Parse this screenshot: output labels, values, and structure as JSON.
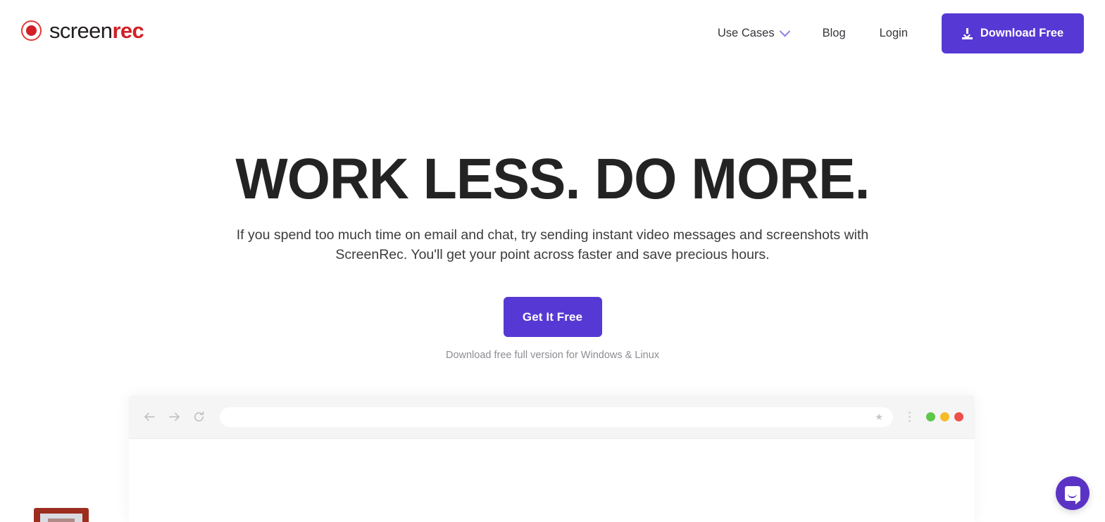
{
  "brand": {
    "logo_mark": "record-circle-icon",
    "name_part1": "screen",
    "name_part2": "rec",
    "accent_purple": "#5639d4",
    "accent_red": "#d31f26"
  },
  "header": {
    "nav": [
      {
        "label": "Use Cases",
        "has_dropdown": true,
        "icon": "chevron-down-icon"
      },
      {
        "label": "Blog",
        "has_dropdown": false
      },
      {
        "label": "Login",
        "has_dropdown": false
      }
    ],
    "download_button": {
      "label": "Download Free",
      "icon": "download-icon",
      "color": "#5639d4"
    }
  },
  "hero": {
    "headline": "WORK LESS. DO MORE.",
    "subheadline": "If you spend too much time on email and chat, try sending instant video messages and screenshots with ScreenRec. You'll get your point across faster and save precious hours.",
    "cta_label": "Get It Free",
    "cta_note": "Download free full version for Windows & Linux"
  },
  "browser_mockup": {
    "back_icon": "arrow-left-icon",
    "forward_icon": "arrow-right-icon",
    "reload_icon": "reload-icon",
    "url_value": "",
    "url_placeholder": "",
    "bookmark_icon": "star-icon",
    "menu_icon": "kebab-menu-icon",
    "window_dots": [
      {
        "name": "green",
        "color": "#5fc74c"
      },
      {
        "name": "yellow",
        "color": "#f5bb27"
      },
      {
        "name": "red",
        "color": "#ef4f4a"
      }
    ]
  },
  "chat_widget": {
    "icon": "intercom-chat-icon",
    "color": "#5b33c4"
  },
  "illustration": {
    "name": "framed-picture-illustration",
    "color": "#9c2d1f"
  }
}
